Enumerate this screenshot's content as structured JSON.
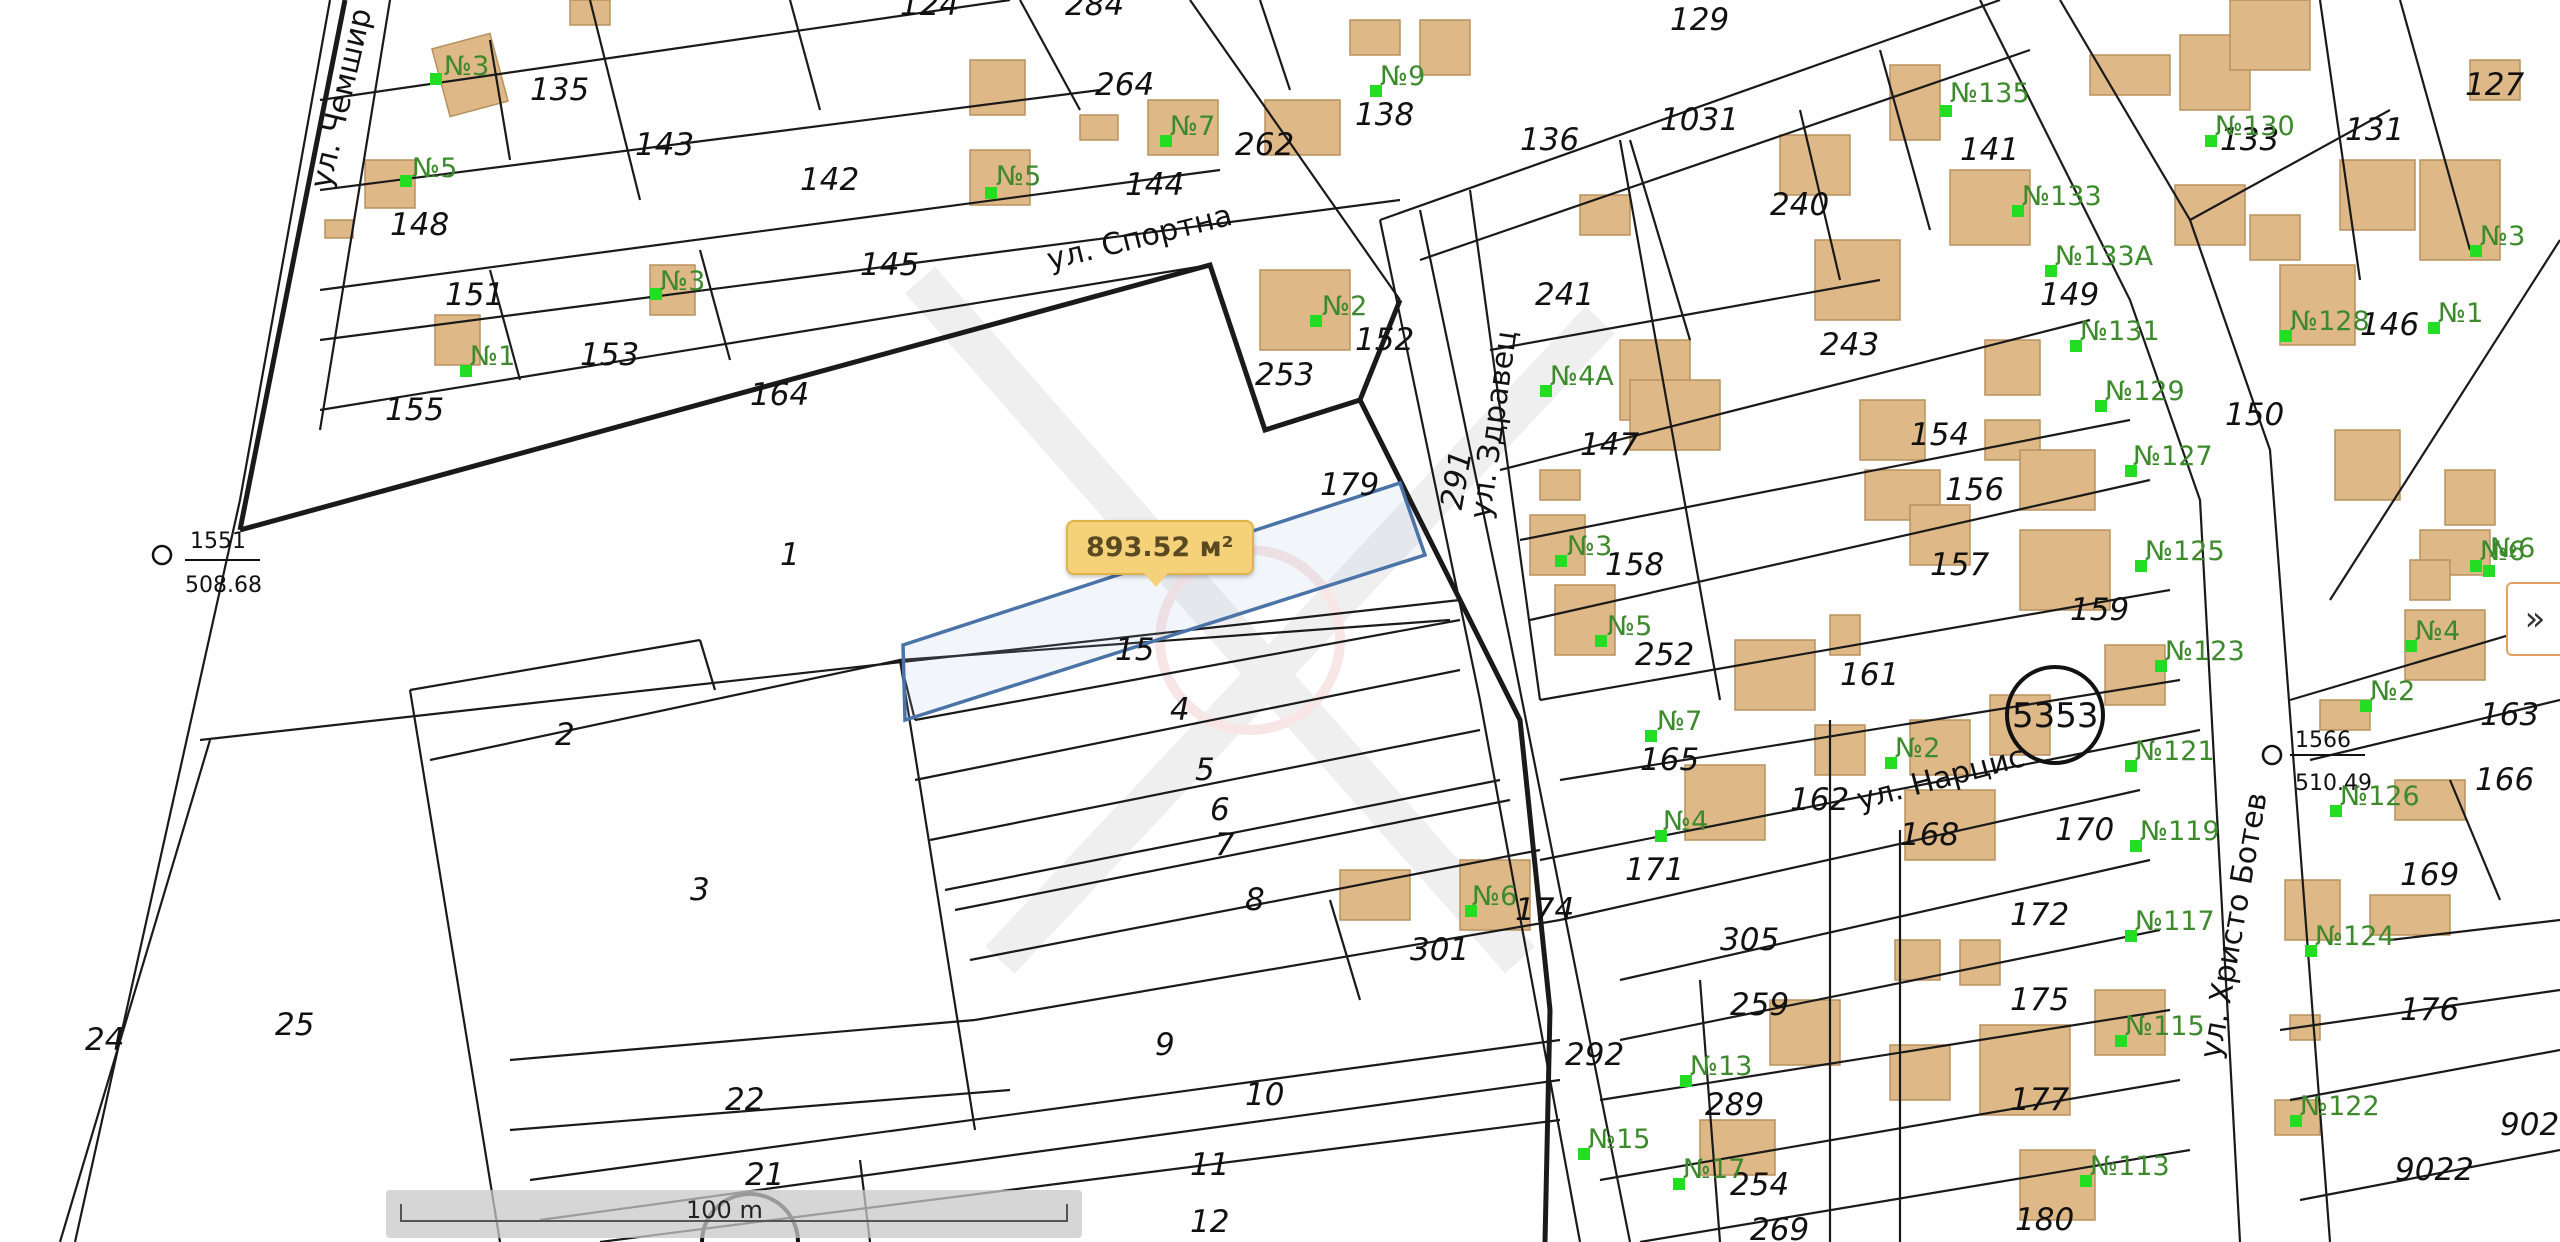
{
  "streets": [
    "ул. Чемшир",
    "ул. Спортна",
    "ул. Здравец",
    "ул. Христо Ботев",
    "ул. Нарцис"
  ],
  "parcels": [
    "1",
    "2",
    "3",
    "4",
    "5",
    "6",
    "7",
    "8",
    "9",
    "10",
    "11",
    "12",
    "15",
    "21",
    "22",
    "24",
    "25",
    "124",
    "135",
    "143",
    "142",
    "145",
    "148",
    "151",
    "153",
    "155",
    "164",
    "264",
    "144",
    "262",
    "138",
    "136",
    "1031",
    "240",
    "141",
    "133",
    "131",
    "127",
    "253",
    "152",
    "179",
    "241",
    "243",
    "149",
    "150",
    "146",
    "147",
    "154",
    "156",
    "158",
    "157",
    "159",
    "252",
    "161",
    "165",
    "162",
    "168",
    "170",
    "171",
    "174",
    "301",
    "305",
    "259",
    "292",
    "289",
    "254",
    "269",
    "172",
    "175",
    "177",
    "180",
    "169",
    "176",
    "9022",
    "902",
    "163",
    "166",
    "291",
    "129",
    "284"
  ],
  "addresses": [
    "№3",
    "№5",
    "№1",
    "№3",
    "№5",
    "№7",
    "№9",
    "№2",
    "№4А",
    "№3",
    "№5",
    "№7",
    "№2",
    "№4",
    "№6",
    "№6",
    "№135",
    "№133",
    "№133А",
    "№131",
    "№129",
    "№127",
    "№125",
    "№123",
    "№121",
    "№119",
    "№117",
    "№115",
    "№113",
    "№13",
    "№15",
    "№17",
    "№130",
    "№128",
    "№1",
    "№3",
    "№6",
    "№4",
    "№2",
    "№126",
    "№124",
    "№122"
  ],
  "survey_points": [
    {
      "id": "1551",
      "elev": "508.68"
    },
    {
      "id": "1566",
      "elev": "510.49"
    }
  ],
  "block_label": "5353",
  "selection": {
    "parcel": "15",
    "area": "893.52 м²"
  },
  "controls": {
    "expand": "»"
  },
  "scale": {
    "label": "100 m"
  },
  "colors": {
    "building": "#deb887",
    "address": "#3c8a2c",
    "selection": "#4a73a8",
    "badge": "#f5d27a"
  }
}
